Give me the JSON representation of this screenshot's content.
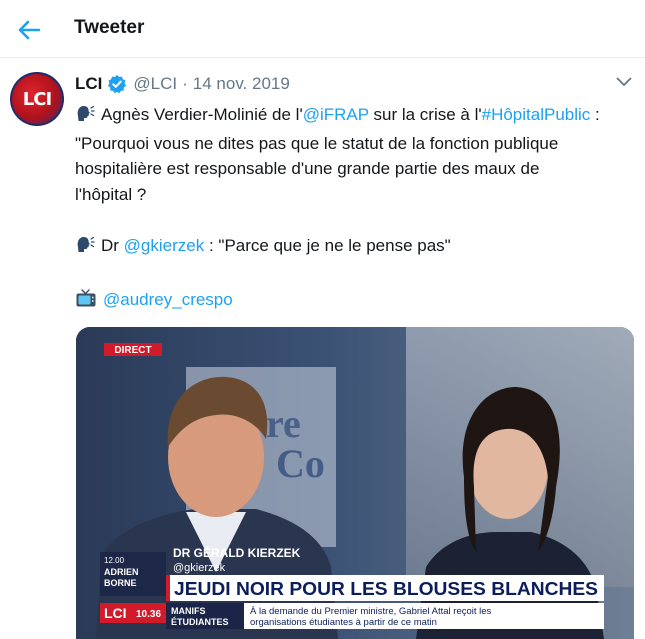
{
  "header": {
    "title": "Tweeter"
  },
  "tweet": {
    "author_name": "LCI",
    "author_handle": "@LCI",
    "separator": "·",
    "date": "14 nov. 2019",
    "avatar_text": "LCI",
    "lines": {
      "l1_pre": "Agnès Verdier-Molinié de l'",
      "l1_link1": "@iFRAP",
      "l1_mid": " sur la crise à l'",
      "l1_link2": "#HôpitalPublic",
      "l1_post": " :",
      "l2": "\"Pourquoi vous ne dites pas que le statut de la fonction publique",
      "l3": "hospitalière est responsable d'une grande partie des maux de",
      "l4": "l'hôpital ?",
      "l5_pre": "Dr ",
      "l5_link": "@gkierzek",
      "l5_post": " : \"Parce que je ne le pense pas\"",
      "l6_link": "@audrey_crespo"
    }
  },
  "media": {
    "live_badge": "DIRECT",
    "bg_text_1": "re",
    "bg_text_2": "Co",
    "speaker_name": "DR GÉRALD KIERZEK",
    "speaker_handle": "@gkierzek",
    "show_time": "12.00",
    "show_host_1": "ADRIEN",
    "show_host_2": "BORNE",
    "headline": "JEUDI NOIR POUR LES BLOUSES BLANCHES",
    "channel": "LCI",
    "clock": "10.36",
    "topic_1": "MANIFS",
    "topic_2": "ÉTUDIANTES",
    "ticker_1": "À la demande du Premier ministre, Gabriel Attal reçoit les",
    "ticker_2": "organisations étudiantes à partir de ce matin"
  },
  "colors": {
    "link": "#1da1f2",
    "verified": "#1da1f2",
    "headline_bg": "#ffffff",
    "headline_text": "#0b1e5b",
    "live_badge": "#d11a2a"
  }
}
